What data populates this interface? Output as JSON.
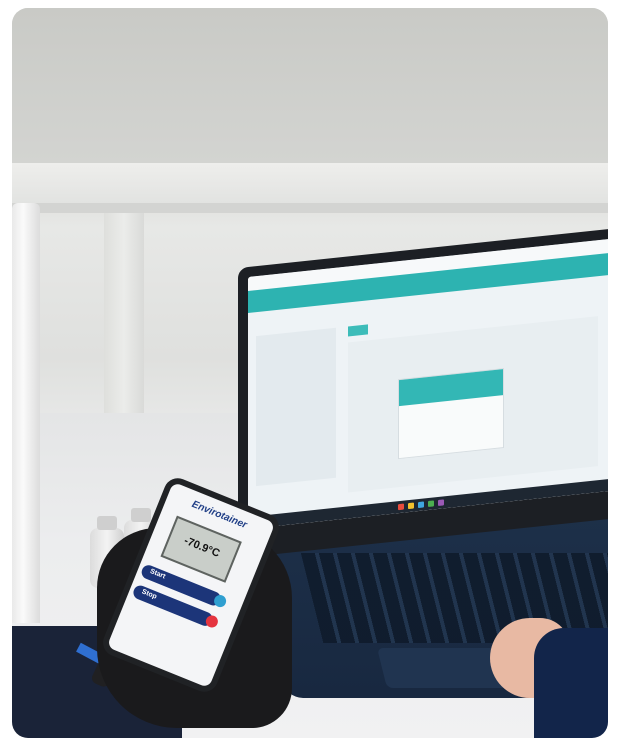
{
  "photo": {
    "device": {
      "brand": "Envirotainer",
      "reading": "-70.9°C",
      "start_label": "Start",
      "stop_label": "Stop"
    },
    "colors": {
      "app_accent": "#2db3b1",
      "device_button": "#1c3579",
      "start_indicator": "#2f9fd0",
      "stop_indicator": "#e5343f"
    }
  }
}
